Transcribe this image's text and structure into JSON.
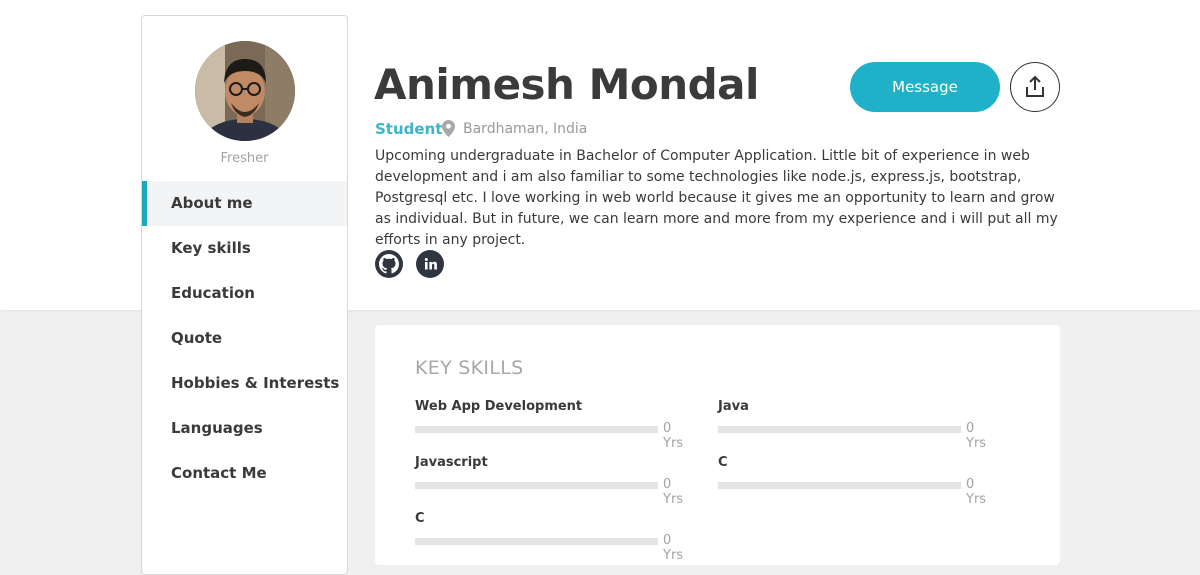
{
  "profile": {
    "name": "Animesh Mondal",
    "role": "Student",
    "location": "Bardhaman, India",
    "status": "Fresher",
    "bio": "Upcoming undergraduate in Bachelor of Computer Application. Little bit of experience in web development and i am also familiar to some technologies like node.js, express.js, bootstrap, Postgresql etc. I love working in web world because it gives me an opportunity to learn and grow as individual. But in future, we can learn more and more from my experience and i will put all my efforts in any project."
  },
  "actions": {
    "message_label": "Message",
    "share_icon": "share-icon"
  },
  "social": [
    {
      "icon": "github-icon"
    },
    {
      "icon": "linkedin-icon"
    }
  ],
  "nav": {
    "items": [
      {
        "label": "About me",
        "active": true
      },
      {
        "label": "Key skills"
      },
      {
        "label": "Education"
      },
      {
        "label": "Quote"
      },
      {
        "label": "Hobbies & Interests"
      },
      {
        "label": "Languages"
      },
      {
        "label": "Contact Me"
      }
    ]
  },
  "skills": {
    "title": "KEY SKILLS",
    "items": [
      {
        "name": "Web App Development",
        "years": "0 Yrs",
        "level": 0
      },
      {
        "name": "Java",
        "years": "0 Yrs",
        "level": 0
      },
      {
        "name": "Javascript",
        "years": "0 Yrs",
        "level": 0
      },
      {
        "name": "C",
        "years": "0 Yrs",
        "level": 0
      },
      {
        "name": "C",
        "years": "0 Yrs",
        "level": 0
      }
    ]
  },
  "colors": {
    "accent": "#1fb1c7",
    "role": "#3bb6c9",
    "dark": "#2f3640"
  }
}
